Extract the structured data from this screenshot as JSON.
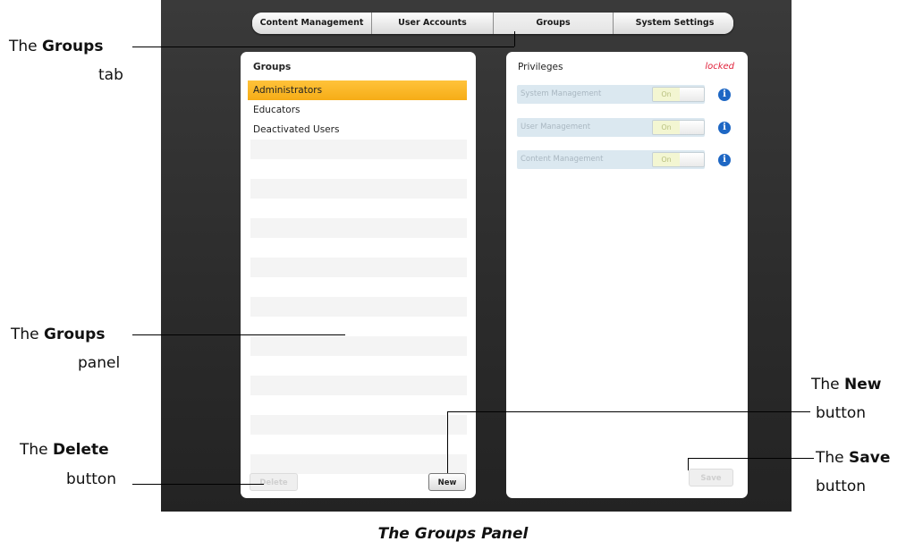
{
  "tabs": [
    {
      "label": "Content Management",
      "active": false
    },
    {
      "label": "User Accounts",
      "active": false
    },
    {
      "label": "Groups",
      "active": true
    },
    {
      "label": "System Settings",
      "active": false
    }
  ],
  "groups_panel": {
    "heading": "Groups",
    "items": [
      "Administrators",
      "Educators",
      "Deactivated Users"
    ],
    "selected": "Administrators",
    "delete_label": "Delete",
    "new_label": "New"
  },
  "privileges_panel": {
    "heading": "Privileges",
    "status": "locked",
    "status_color": "#e0203a",
    "items": [
      {
        "label": "System Management",
        "value": "On"
      },
      {
        "label": "User Management",
        "value": "On"
      },
      {
        "label": "Content Management",
        "value": "On"
      }
    ],
    "info_icon": "info-icon",
    "save_label": "Save"
  },
  "annotations": {
    "groups_tab": {
      "pre": "The ",
      "bold": "Groups",
      "line2": "tab"
    },
    "groups_panel": {
      "pre": "The ",
      "bold": "Groups",
      "line2": "panel"
    },
    "delete_button": {
      "pre": "The ",
      "bold": "Delete",
      "line2": "button"
    },
    "new_button": {
      "pre": "The ",
      "bold": "New",
      "line2": "button"
    },
    "save_button": {
      "pre": "The ",
      "bold": "Save",
      "line2": "button"
    }
  },
  "caption": "The Groups Panel",
  "colors": {
    "selection": "#f9b62a",
    "accent_blue": "#1e67c4",
    "frame": "#2e2e2e"
  }
}
